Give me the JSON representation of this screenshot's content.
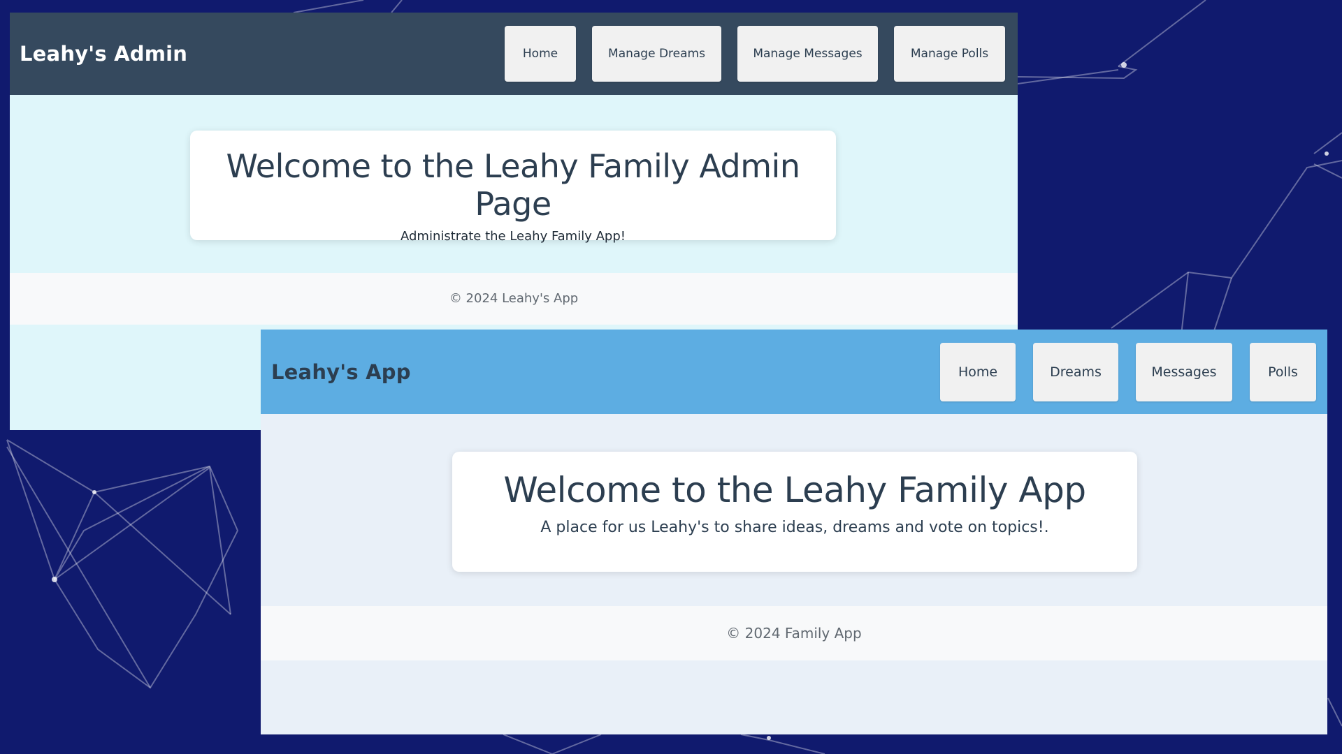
{
  "admin": {
    "brand": "Leahy's Admin",
    "nav": [
      "Home",
      "Manage Dreams",
      "Manage Messages",
      "Manage Polls"
    ],
    "hero_title": "Welcome to the Leahy Family Admin Page",
    "hero_subtitle": "Administrate the Leahy Family App!",
    "footer": "© 2024 Leahy's App",
    "colors": {
      "navbar": "#35495e",
      "page_bg": "#dff6fa"
    }
  },
  "app": {
    "brand": "Leahy's App",
    "nav": [
      "Home",
      "Dreams",
      "Messages",
      "Polls"
    ],
    "hero_title": "Welcome to the Leahy Family App",
    "hero_subtitle": "A place for us Leahy's to share ideas, dreams and vote on topics!.",
    "footer": "© 2024 Family App",
    "colors": {
      "navbar": "#5dade2",
      "page_bg": "#e9f0f8"
    }
  },
  "desktop": {
    "background_color": "#101a6e"
  }
}
